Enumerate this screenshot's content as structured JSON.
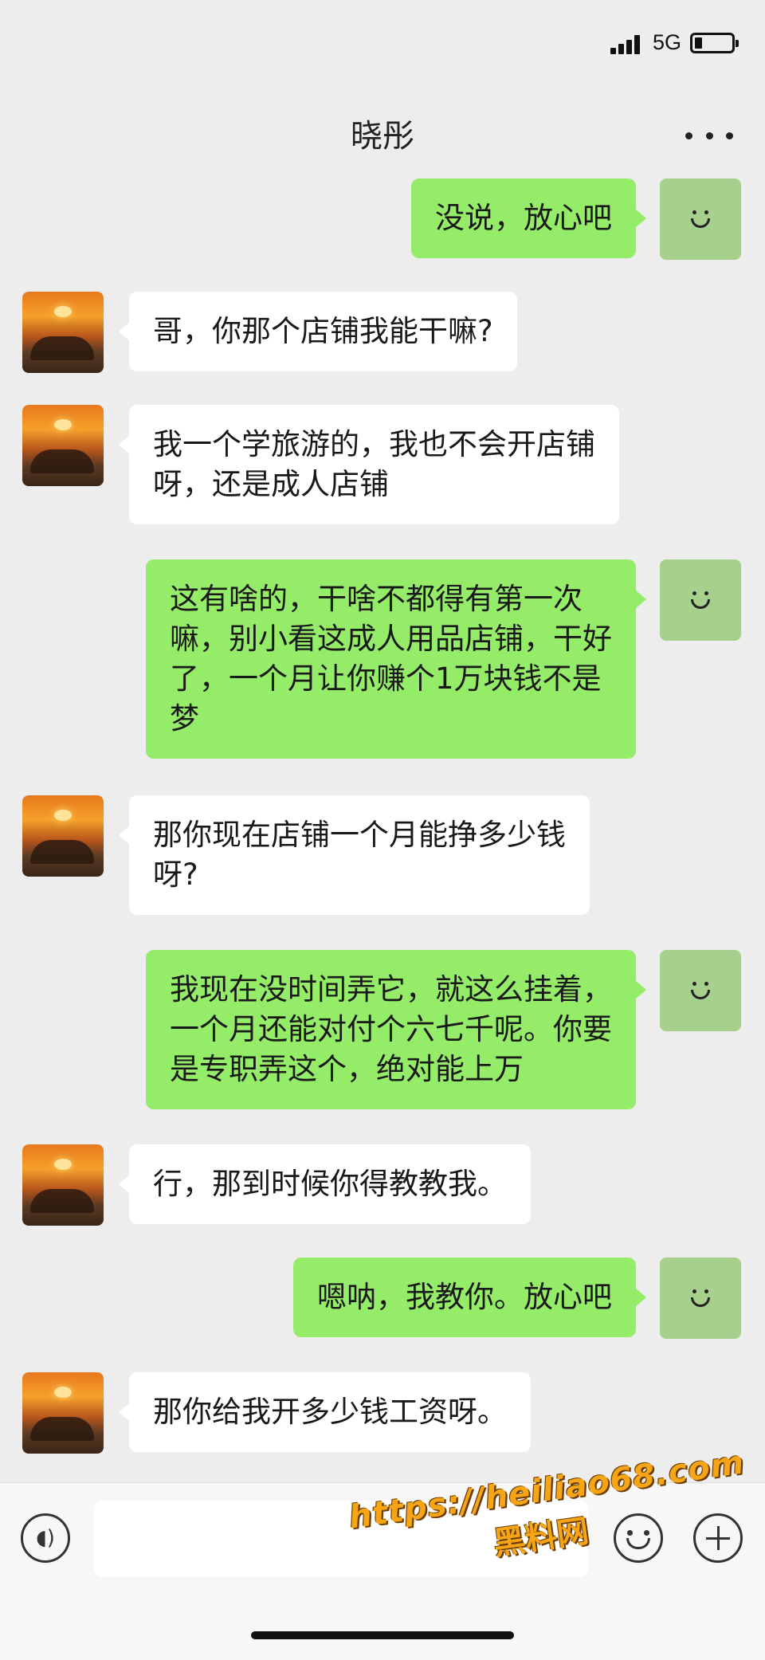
{
  "status_bar": {
    "network": "5G"
  },
  "header": {
    "title": "晓彤"
  },
  "messages": [
    {
      "side": "out",
      "text": "没说，放心吧"
    },
    {
      "side": "in",
      "text": "哥，你那个店铺我能干嘛?"
    },
    {
      "side": "in",
      "text": "我一个学旅游的，我也不会开店铺\n呀，还是成人店铺"
    },
    {
      "side": "out",
      "text": "这有啥的，干啥不都得有第一次\n嘛，别小看这成人用品店铺，干好\n了，一个月让你赚个1万块钱不是\n梦"
    },
    {
      "side": "in",
      "text": "那你现在店铺一个月能挣多少钱\n呀?"
    },
    {
      "side": "out",
      "text": "我现在没时间弄它，就这么挂着，\n一个月还能对付个六七千呢。你要\n是专职弄这个，绝对能上万"
    },
    {
      "side": "in",
      "text": "行，那到时候你得教教我。"
    },
    {
      "side": "out",
      "text": "嗯呐，我教你。放心吧"
    },
    {
      "side": "in",
      "text": "那你给我开多少钱工资呀。"
    }
  ],
  "input_bar": {
    "text_value": ""
  },
  "watermark": {
    "url": "https://heiliao68.com",
    "name": "黑料网"
  },
  "icons": [
    "signal-icon",
    "battery-icon",
    "more-icon",
    "voice-icon",
    "emoji-icon",
    "plus-icon"
  ]
}
